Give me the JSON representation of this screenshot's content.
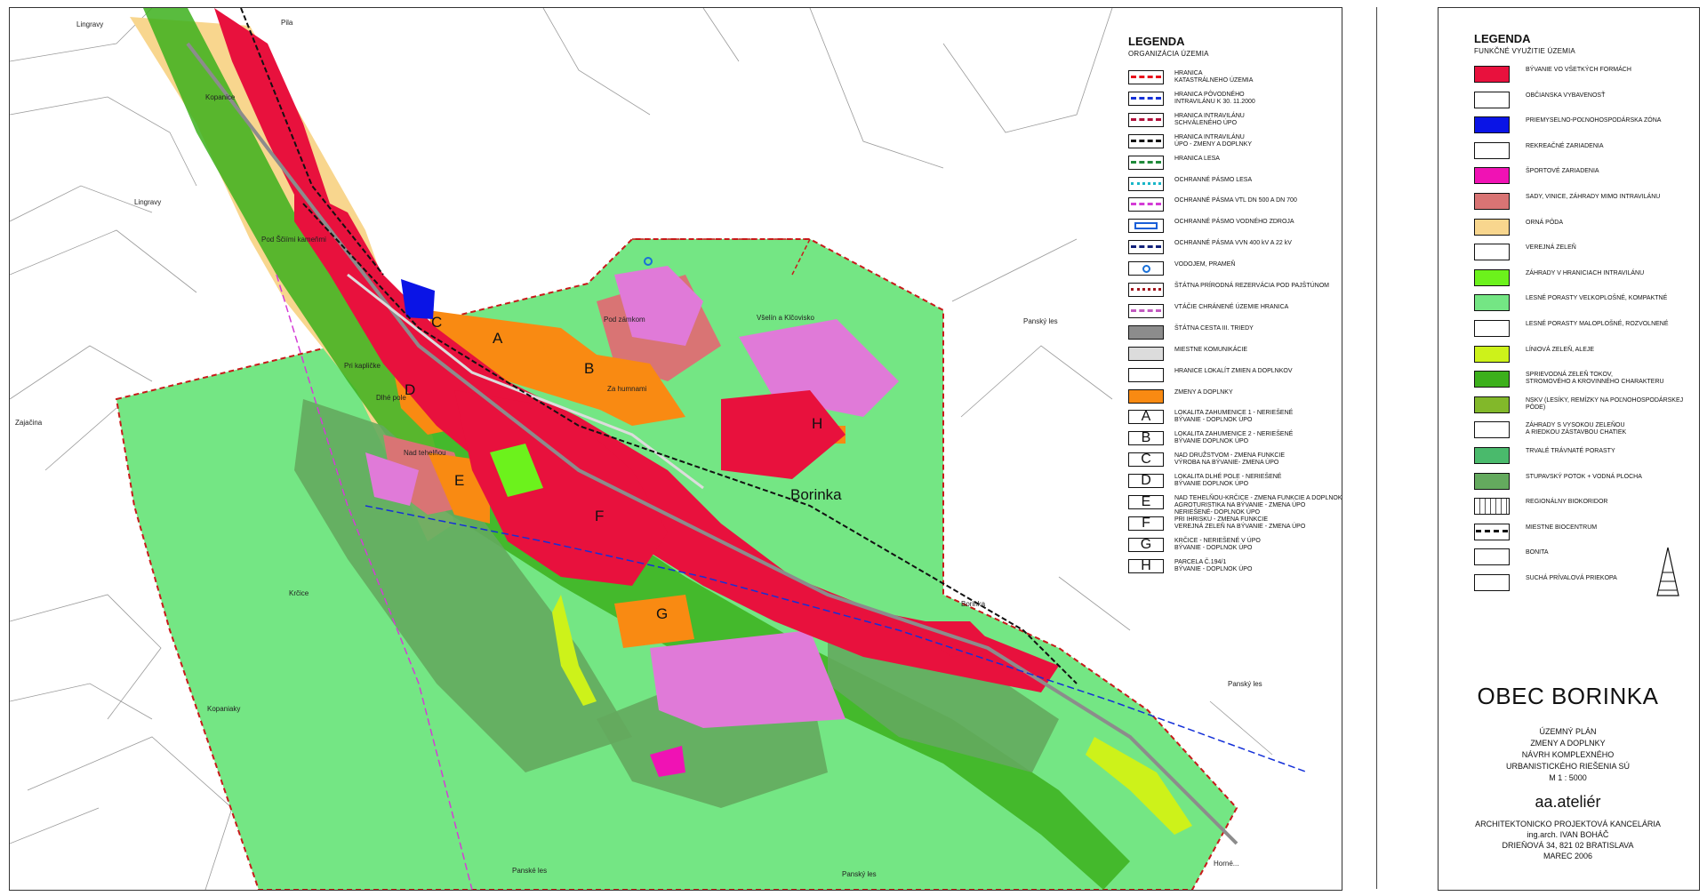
{
  "legend_organizacia": {
    "title": "LEGENDA",
    "subtitle": "ORGANIZÁCIA ÚZEMIA",
    "items": [
      {
        "label": "HRANICA\nKATASTRÁLNEHO ÚZEMIA",
        "swatch": "dash",
        "color": "#e8101b"
      },
      {
        "label": "HRANICA PÔVODNÉHO\nINTRAVILÁNU K 30. 11.2000",
        "swatch": "dash",
        "color": "#1430d8"
      },
      {
        "label": "HRANICA INTRAVILÁNU\nSCHVÁLENÉHO ÚPO",
        "swatch": "dash",
        "color": "#b0103b"
      },
      {
        "label": "HRANICA INTRAVILÁNU\nÚPO - ZMENY A DOPLNKY",
        "swatch": "dash",
        "color": "#111111"
      },
      {
        "label": "HRANICA LESA",
        "swatch": "dash",
        "color": "#1f8a3a"
      },
      {
        "label": "OCHRANNÉ PÁSMO LESA",
        "swatch": "dot",
        "color": "#19b6c8"
      },
      {
        "label": "OCHRANNÉ PÁSMA VTL DN 500 A DN 700",
        "swatch": "dash",
        "color": "#d43cd6"
      },
      {
        "label": "OCHRANNÉ PÁSMO VODNÉHO ZDROJA",
        "swatch": "box",
        "color": "#1a5fd8"
      },
      {
        "label": "OCHRANNÉ PÁSMA VVN 400 kV A 22 kV",
        "swatch": "dash",
        "color": "#10207a"
      },
      {
        "label": "VODOJEM, PRAMEŇ",
        "swatch": "circle",
        "color": "#1a70d8"
      },
      {
        "label": "ŠTÁTNA PRÍRODNÁ REZERVÁCIA POD PAJŠTÚNOM",
        "swatch": "dot",
        "color": "#a0161e"
      },
      {
        "label": "VTÁČIE CHRÁNENÉ ÚZEMIE HRANICA",
        "swatch": "dash",
        "color": "#c25ac0"
      },
      {
        "label": "ŠTÁTNA CESTA III. TRIEDY",
        "swatch": "fill",
        "color": "#8c8c8c"
      },
      {
        "label": "MIESTNE KOMUNIKÁCIE",
        "swatch": "fill",
        "color": "#dcdcdc"
      },
      {
        "label": "HRANICE LOKALÍT ZMIEN A DOPLNKOV",
        "swatch": "fill",
        "color": "#ffffff"
      },
      {
        "label": "ZMENY A DOPLNKY",
        "swatch": "fill",
        "color": "#f98a12"
      },
      {
        "label": "LOKALITA ZAHUMENICE 1 - NERIEŠENÉ\nBÝVANIE - DOPLNOK ÚPO",
        "swatch": "letter",
        "letter": "A"
      },
      {
        "label": "LOKALITA ZAHUMENICE 2 - NERIEŠENÉ\nBÝVANIE DOPLNOK ÚPO",
        "swatch": "letter",
        "letter": "B"
      },
      {
        "label": "NAD DRUŽSTVOM - ZMENA FUNKCIE\nVÝROBA NA BÝVANIE- ZMENA ÚPO",
        "swatch": "letter",
        "letter": "C"
      },
      {
        "label": "LOKALITA DLHÉ POLE - NERIEŠENÉ\nBÝVANIE DOPLNOK ÚPO",
        "swatch": "letter",
        "letter": "D"
      },
      {
        "label": "NAD TEHELŇOU-KRČICE - ZMENA FUNKCIE A DOPLNOK\nAGROTURISTIKA NA BÝVANIE - ZMENA ÚPO\nNERIEŠENÉ- DOPLNOK ÚPO",
        "swatch": "letter",
        "letter": "E"
      },
      {
        "label": "PRI IHRISKU - ZMENA FUNKCIE\nVEREJNÁ ZELEŇ NA BÝVANIE - ZMENA ÚPO",
        "swatch": "letter",
        "letter": "F"
      },
      {
        "label": "KRČICE - NERIEŠENÉ V ÚPO\nBÝVANIE - DOPLNOK ÚPO",
        "swatch": "letter",
        "letter": "G"
      },
      {
        "label": "PARCELA Č.194/1\nBÝVANIE - DOPLNOK ÚPO",
        "swatch": "letter",
        "letter": "H"
      }
    ]
  },
  "legend_funkcne": {
    "title": "LEGENDA",
    "subtitle": "FUNKČNÉ VYUŽITIE ÚZEMIA",
    "items": [
      {
        "label": "BÝVANIE VO VŠETKÝCH FORMÁCH",
        "color": "#e8113d"
      },
      {
        "label": "OBČIANSKA VYBAVENOSŤ",
        "color": "#ffffff"
      },
      {
        "label": "PRIEMYSELNO-POĽNOHOSPODÁRSKA ZÓNA",
        "color": "#0a14e6"
      },
      {
        "label": "REKREAČNÉ ZARIADENIA",
        "color": "#ffffff"
      },
      {
        "label": "ŠPORTOVÉ ZARIADENIA",
        "color": "#f012b4"
      },
      {
        "label": "SADY, VINICE, ZÁHRADY MIMO INTRAVILÁNU",
        "color": "#d97474"
      },
      {
        "label": "ORNÁ PÔDA",
        "color": "#f8d68e"
      },
      {
        "label": "VEREJNÁ ZELEŇ",
        "color": "#ffffff"
      },
      {
        "label": "ZÁHRADY V HRANICIACH INTRAVILÁNU",
        "color": "#6cf21c"
      },
      {
        "label": "LESNÉ PORASTY VEĽKOPLOŠNÉ, KOMPAKTNÉ",
        "color": "#74e684"
      },
      {
        "label": "LESNÉ PORASTY MALOPLOŠNÉ, ROZVOLNENÉ",
        "color": "#ffffff"
      },
      {
        "label": "LÍNIOVÁ ZELEŇ, ALEJE",
        "color": "#cdf21a"
      },
      {
        "label": "SPRIEVODNÁ ZELEŇ TOKOV,\nSTROMOVÉHO A KROVINNÉHO CHARAKTERU",
        "color": "#3cb01c"
      },
      {
        "label": "NSKV (LESÍKY, REMÍZKY NA POĽNOHOSPODÁRSKEJ PÔDE)",
        "color": "#82b82a"
      },
      {
        "label": "ZÁHRADY S VYSOKOU ZELEŇOU\nA RIEDKOU ZÁSTAVBOU CHATIEK",
        "color": "#ffffff"
      },
      {
        "label": "TRVALÉ TRÁVNATÉ PORASTY",
        "color": "#4aba6c"
      },
      {
        "label": "STUPAVSKÝ POTOK + VODNÁ PLOCHA",
        "color": "#64aa5e"
      },
      {
        "label": "REGIONÁLNY BIOKORIDOR",
        "color": "#ffffff"
      },
      {
        "label": "MIESTNE BIOCENTRUM",
        "color": "#ffffff"
      },
      {
        "label": "BONITA",
        "color": "#ffffff"
      },
      {
        "label": "SUCHÁ PRÍVALOVÁ PRIEKOPA",
        "color": "#ffffff"
      }
    ]
  },
  "title_block": {
    "obec": "OBEC BORINKA",
    "lines": [
      "ÚZEMNÝ PLÁN",
      "ZMENY A DOPLNKY",
      "NÁVRH KOMPLEXNÉHO",
      "URBANISTICKÉHO RIEŠENIA SÚ",
      "M 1 : 5000"
    ],
    "studio": "aa.ateliér",
    "studio_lines": [
      "ARCHITEKTONICKO PROJEKTOVÁ KANCELÁRIA",
      "ing.arch. IVAN BOHÁČ",
      "DRIEŇOVÁ 34, 821 02 BRATISLAVA",
      "MAREC 2006"
    ]
  },
  "map": {
    "place_labels": [
      "Lingravy",
      "Pila",
      "Kopanice",
      "Lingravy",
      "Pod Ščiími kameňmi",
      "Pod zámkom",
      "Všelín a Klčovisko",
      "Panský les",
      "Zajačina",
      "Pri kapličke",
      "Dlhé pole",
      "Za humnami",
      "Nad tehelňou",
      "Krčice",
      "Kopaniaky",
      "Borinka",
      "Panský les",
      "Panské les",
      "Panský les",
      "Horné..."
    ],
    "town_name": "Borinka",
    "locality_letters": [
      "A",
      "B",
      "C",
      "D",
      "E",
      "F",
      "G",
      "H"
    ]
  }
}
